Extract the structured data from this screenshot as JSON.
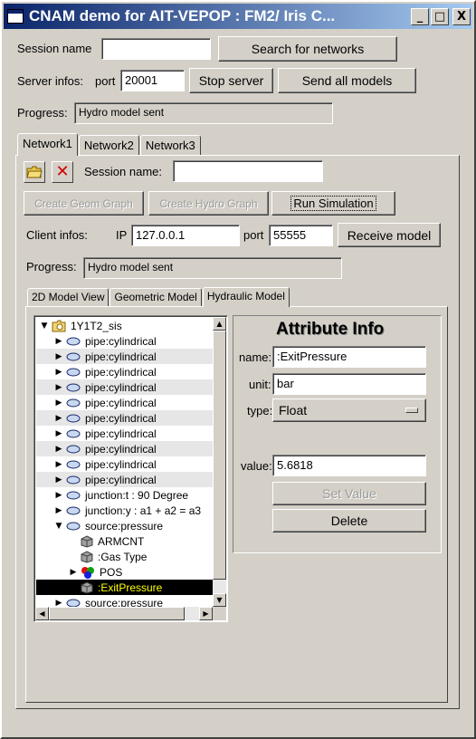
{
  "window": {
    "title": "CNAM demo for AIT-VEPOP : FM2/ Iris C...",
    "controls": [
      "_",
      "□",
      "X"
    ]
  },
  "top": {
    "session_name_label": "Session name",
    "session_name_value": "",
    "search_button": "Search for networks",
    "server_infos_label": "Server infos:",
    "port_label": "port",
    "port_value": "20001",
    "stop_server_button": "Stop server",
    "send_all_models_button": "Send all models",
    "progress_label": "Progress:",
    "progress_value": "Hydro model sent"
  },
  "network_tabs": [
    "Network1",
    "Network2",
    "Network3"
  ],
  "network": {
    "session_name_label": "Session name:",
    "session_name_value": "",
    "create_geom_graph": "Create Geom Graph",
    "create_hydro_graph": "Create Hydro Graph",
    "run_simulation": "Run Simulation",
    "client_infos_label": "Client infos:",
    "ip_label": "IP",
    "ip_value": "127.0.0.1",
    "port_label": "port",
    "port_value": "55555",
    "receive_model_button": "Receive model",
    "progress_label": "Progress:",
    "progress_value": "Hydro model sent"
  },
  "model_tabs": [
    "2D Model View",
    "Geometric Model",
    "Hydraulic Model"
  ],
  "tree": {
    "root": "1Y1T2_sis",
    "items": [
      "pipe:cylindrical",
      "pipe:cylindrical",
      "pipe:cylindrical",
      "pipe:cylindrical",
      "pipe:cylindrical",
      "pipe:cylindrical",
      "pipe:cylindrical",
      "pipe:cylindrical",
      "pipe:cylindrical",
      "pipe:cylindrical",
      "junction:t : 90 Degree",
      "junction:y : a1 + a2 = a3",
      "source:pressure",
      "ARMCNT",
      ":Gas Type",
      "POS",
      ":ExitPressure",
      "source:pressure"
    ]
  },
  "attribute_info": {
    "title": "Attribute Info",
    "name_label": "name:",
    "name_value": ":ExitPressure",
    "unit_label": "unit:",
    "unit_value": "bar",
    "type_label": "type:",
    "type_value": "Float",
    "value_label": "value:",
    "value_value": "5.6818",
    "set_value_button": "Set Value",
    "delete_button": "Delete"
  }
}
